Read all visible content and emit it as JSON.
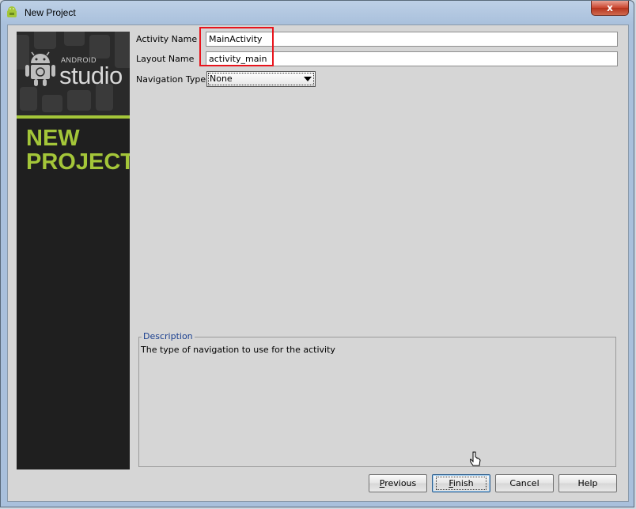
{
  "window": {
    "title": "New Project",
    "close_glyph": "x",
    "accent_color": "#a4c639"
  },
  "sidebar": {
    "logo_small": "ANDROID",
    "logo_big": "studio",
    "headline_line1": "NEW",
    "headline_line2": "PROJECT"
  },
  "form": {
    "activity_name": {
      "label": "Activity Name",
      "value": "MainActivity"
    },
    "layout_name": {
      "label": "Layout Name",
      "value": "activity_main"
    },
    "navigation_type": {
      "label": "Navigation Type",
      "value": "None"
    }
  },
  "description": {
    "legend": "Description",
    "text": "The type of navigation to use for the activity"
  },
  "buttons": {
    "previous": {
      "mnemonic": "P",
      "rest": "revious"
    },
    "finish": {
      "mnemonic": "F",
      "rest": "inish"
    },
    "cancel": "Cancel",
    "help": "Help"
  }
}
